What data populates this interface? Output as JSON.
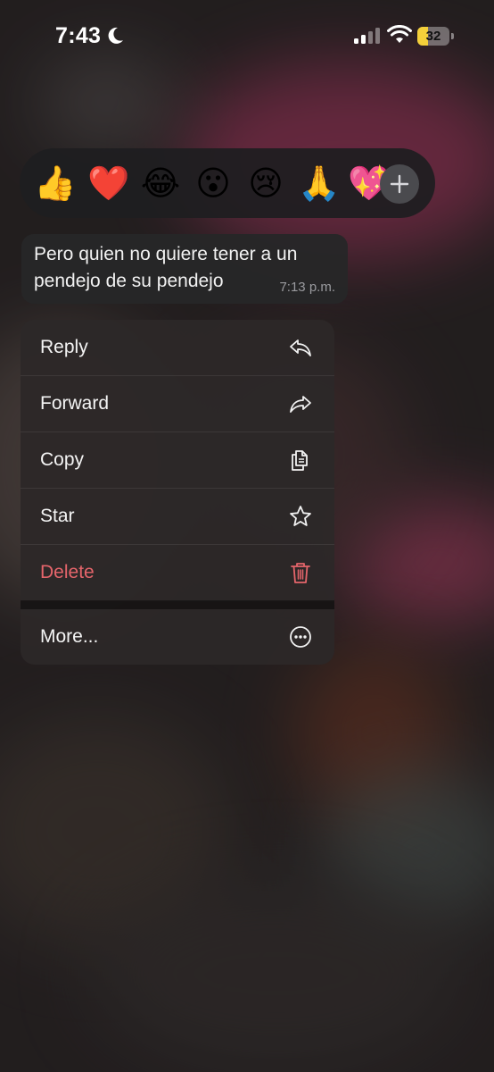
{
  "status_bar": {
    "time": "7:43",
    "battery_level": "32",
    "battery_fraction": 0.32,
    "battery_color": "#f4d03a"
  },
  "reactions": {
    "emojis": [
      "👍",
      "❤️",
      "😂",
      "😮",
      "😢",
      "🙏",
      "💖"
    ],
    "more_icon": "plus-icon"
  },
  "message": {
    "text": "Pero quien no quiere tener a un pendejo de su pendejo",
    "time": "7:13 p.m."
  },
  "menu": {
    "items": [
      {
        "label": "Reply",
        "icon": "reply-icon"
      },
      {
        "label": "Forward",
        "icon": "forward-icon"
      },
      {
        "label": "Copy",
        "icon": "copy-icon"
      },
      {
        "label": "Star",
        "icon": "star-icon"
      },
      {
        "label": "Delete",
        "icon": "trash-icon",
        "color": "#e5656b"
      },
      {
        "label": "More...",
        "icon": "more-icon"
      }
    ]
  }
}
